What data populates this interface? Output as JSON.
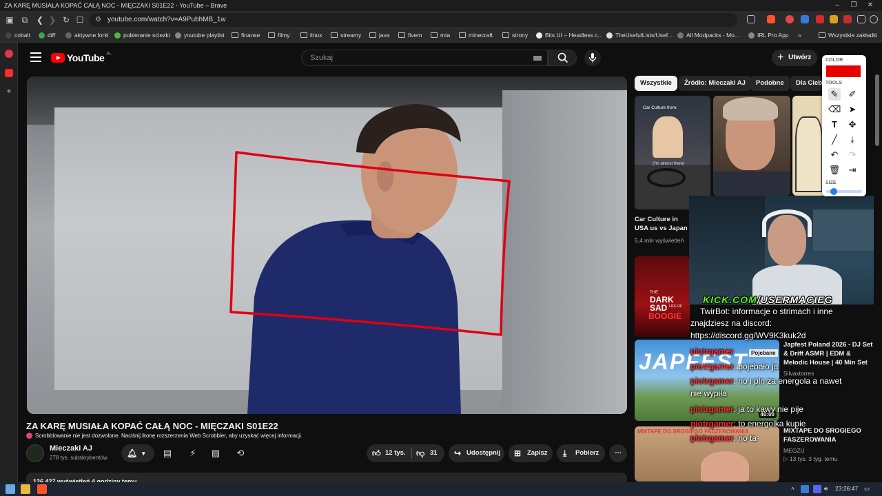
{
  "browser": {
    "window_title": "ZA KARĘ MUSIAŁA KOPAĆ CAŁĄ NOC - MIĘCZAKI S01E22 - YouTube – Brave",
    "url": "youtube.com/watch?v=A9PubhMB_1w",
    "bookmarks": [
      {
        "label": "cobalt"
      },
      {
        "label": "diff"
      },
      {
        "label": "aktywne forki"
      },
      {
        "label": "pobieranie sciezki"
      },
      {
        "label": "youtube playlist"
      },
      {
        "label": "finanse"
      },
      {
        "label": "filmy"
      },
      {
        "label": "linux"
      },
      {
        "label": "streamy"
      },
      {
        "label": "java"
      },
      {
        "label": "fivem"
      },
      {
        "label": "mta"
      },
      {
        "label": "minecraft"
      },
      {
        "label": "strony"
      },
      {
        "label": "Bits UI – Headless c..."
      },
      {
        "label": "TheUsefulLists/Usef..."
      },
      {
        "label": "All Modpacks - Mo..."
      },
      {
        "label": "IRL Pro App"
      }
    ],
    "more_bookmarks": "»",
    "all_bookmarks": "Wszystkie zakładki"
  },
  "youtube": {
    "logo": "YouTube",
    "logo_region": "PL",
    "search_placeholder": "Szukaj",
    "create_label": "Utwórz",
    "video_title": "ZA KARĘ MUSIAŁA KOPAĆ CAŁĄ NOC - MIĘCZAKI S01E22",
    "scrobble_notice": "Scrobblowanie nie jest dozwolone. Naciśnij ikonę rozszerzenia Web Scrobbler, aby uzyskać więcej informacji.",
    "channel": {
      "name": "Mieczaki AJ",
      "subs": "278 tys. subskrybentów"
    },
    "actions": {
      "likes": "12 tys.",
      "dislikes": "31",
      "share": "Udostępnij",
      "save": "Zapisz",
      "download": "Pobierz",
      "more": "⋯"
    },
    "description_preview": "126 427 wyświetleń  4 godziny temu",
    "chips": [
      {
        "label": "Wszystkie",
        "active": true
      },
      {
        "label": "Źródło: Mieczaki AJ",
        "active": false
      },
      {
        "label": "Podobne",
        "active": false
      },
      {
        "label": "Dla Ciebie",
        "active": false
      }
    ],
    "recommendations": [
      {
        "title_line1": "Car Culture in",
        "title_line2": "USA us vs Japan",
        "meta": "5,4 mln wyświetleń",
        "thumb_text1": "Car Culture from:",
        "thumb_text2": "(I'm almost there)"
      },
      {
        "thumb_text1": "THE",
        "thumb_text2": "DARK",
        "thumb_text3": "SAD",
        "thumb_text4": "BOOGIE",
        "thumb_text5": "LIFE OF"
      },
      {
        "title_line1": "Japfest Poland 2026 - DJ Set",
        "title_line2": "& Drift ASMR | EDM &",
        "title_line3": "Melodic House | 40 Min Set",
        "channel": "Silvaxtorres",
        "duration": "40:09",
        "thumb_text1": "JAPFEST",
        "thumb_text2": "Pojebane"
      },
      {
        "title_line1": "MIXTAPE DO SROGIEGO",
        "title_line2": "FASZEROWANIA",
        "channel": "MEGZU",
        "meta": "▷ 13 tys.   3 tyg. temu",
        "thumb_text1": "MIXTAPE DO SROGIEGO FASZEROWANIA"
      }
    ]
  },
  "overlay": {
    "kick_prefix": "KICK.COM",
    "kick_user": "/USERMACIEG",
    "chat": [
      {
        "text": "TwirBot: informacje o strimach i inne"
      },
      {
        "text": "znajdziesz na discord:"
      },
      {
        "text": "https://discord.gg/WV9K3kuk2d"
      },
      {
        "user": "piotrgamer",
        "msg": ""
      },
      {
        "user": "piotrgamer",
        "msg": ": pojebało ja"
      },
      {
        "user": "piotrgamer",
        "msg": ": no i   pln za energola a nawet"
      },
      {
        "text": "nie wypiła"
      },
      {
        "user": "piotrgamer",
        "msg": ": ja to kawy nie pije"
      },
      {
        "user": "piotrgamer",
        "msg": ": to energolka kupie"
      },
      {
        "user": "piotrgamer",
        "msg": ": no ta"
      }
    ]
  },
  "draw_tools": {
    "color_label": "COLOR",
    "tools_label": "TOOLS",
    "size_label": "SIZE",
    "current_color": "#e80000",
    "size_level": 0.15
  },
  "taskbar": {
    "time": "23:26:47"
  }
}
